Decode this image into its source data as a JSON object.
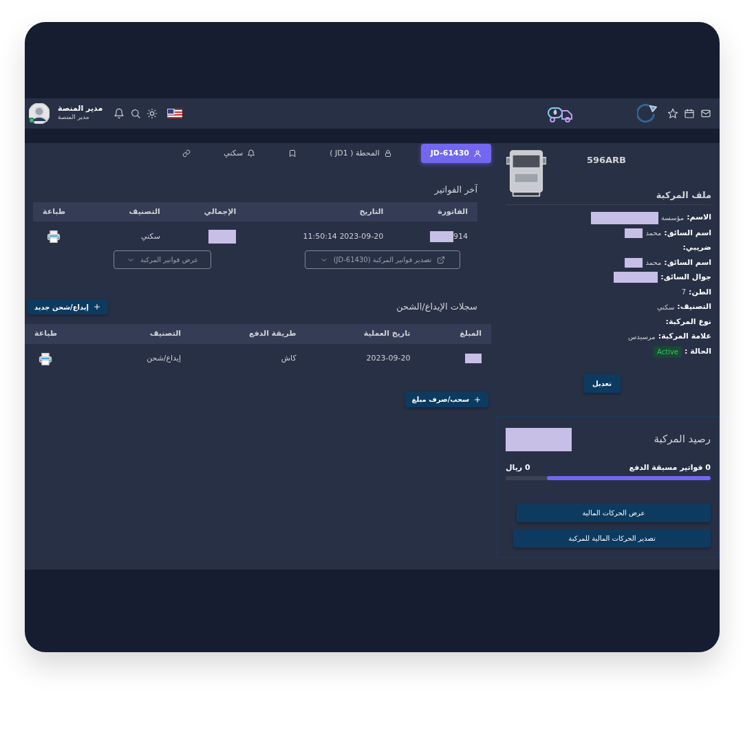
{
  "header": {
    "user": {
      "name": "مدير المنصة",
      "role": "مدير المنصة",
      "online": true
    }
  },
  "tabs": [
    {
      "label": "JD-61430",
      "selected": true
    },
    {
      "label": "المحطة ( JD1 )",
      "selected": false
    },
    {
      "selected": false
    },
    {
      "label": "سكني",
      "selected": false
    },
    {
      "selected": false
    }
  ],
  "invoices": {
    "title": "آخر الفواتير",
    "columns": [
      "الفاتورة",
      "التاريخ",
      "الإجمالي",
      "التصنيف",
      "طباعة"
    ],
    "rows": [
      {
        "invoice": {
          "text": "914",
          "redacted": true
        },
        "date": "2023-09-20 11:50:14",
        "total": {
          "redacted": true
        },
        "category": "سكني"
      }
    ],
    "export_button": "تصدير فواتير المركبة (JD-61430)",
    "view_button": "عرض فواتير المركبة"
  },
  "deposits": {
    "title": "سجلات الإيداع/الشحن",
    "new_button": "إيداع/شحن جديد",
    "columns": [
      "المبلغ",
      "تاريخ العملية",
      "طريقة الدفع",
      "التصنيف",
      "طباعة"
    ],
    "rows": [
      {
        "amount": {
          "redacted": true
        },
        "date": "2023-09-20",
        "method": "كاش",
        "category": "إيداع/شحن"
      }
    ],
    "withdraw_button": "سحب/صرف مبلغ"
  },
  "vehicle": {
    "plate": "596ARB",
    "title": "ملف المركبة",
    "fields": [
      {
        "kind": "text",
        "label": "الاسم:",
        "value": "مؤسسة",
        "redacted": true
      },
      {
        "kind": "text",
        "label": "اسم السائق:",
        "value": "محمد",
        "redacted": true
      },
      {
        "kind": "text",
        "label": "ضريبي:",
        "redacted": false
      },
      {
        "kind": "text",
        "label": "اسم السائق:",
        "value": "محمد",
        "redacted": true
      },
      {
        "kind": "text",
        "label": "جوال السائق:",
        "redacted": true
      },
      {
        "kind": "text",
        "label": "الطن:",
        "value": "7",
        "redacted": false
      },
      {
        "kind": "text",
        "label": "التصنيف:",
        "value": "سكني",
        "redacted": false
      },
      {
        "kind": "text",
        "label": "نوع المركبة:",
        "redacted": false
      },
      {
        "kind": "text",
        "label": "علامة المركبة:",
        "value": "مرسيدس",
        "redacted": false
      },
      {
        "kind": "badge",
        "label": "الحالة :",
        "value": "Active",
        "redacted": false
      }
    ],
    "edit_button": "تعديل"
  },
  "balance": {
    "title": "رصيد المركبة",
    "amount_redacted": true,
    "prepaid": "0 فواتير مسبقة الدفع",
    "riyal": "0 ريال",
    "level": 0.8,
    "buttons": [
      "عرض الحركات المالية",
      "تصدير الحركات المالية للمركبة"
    ]
  }
}
